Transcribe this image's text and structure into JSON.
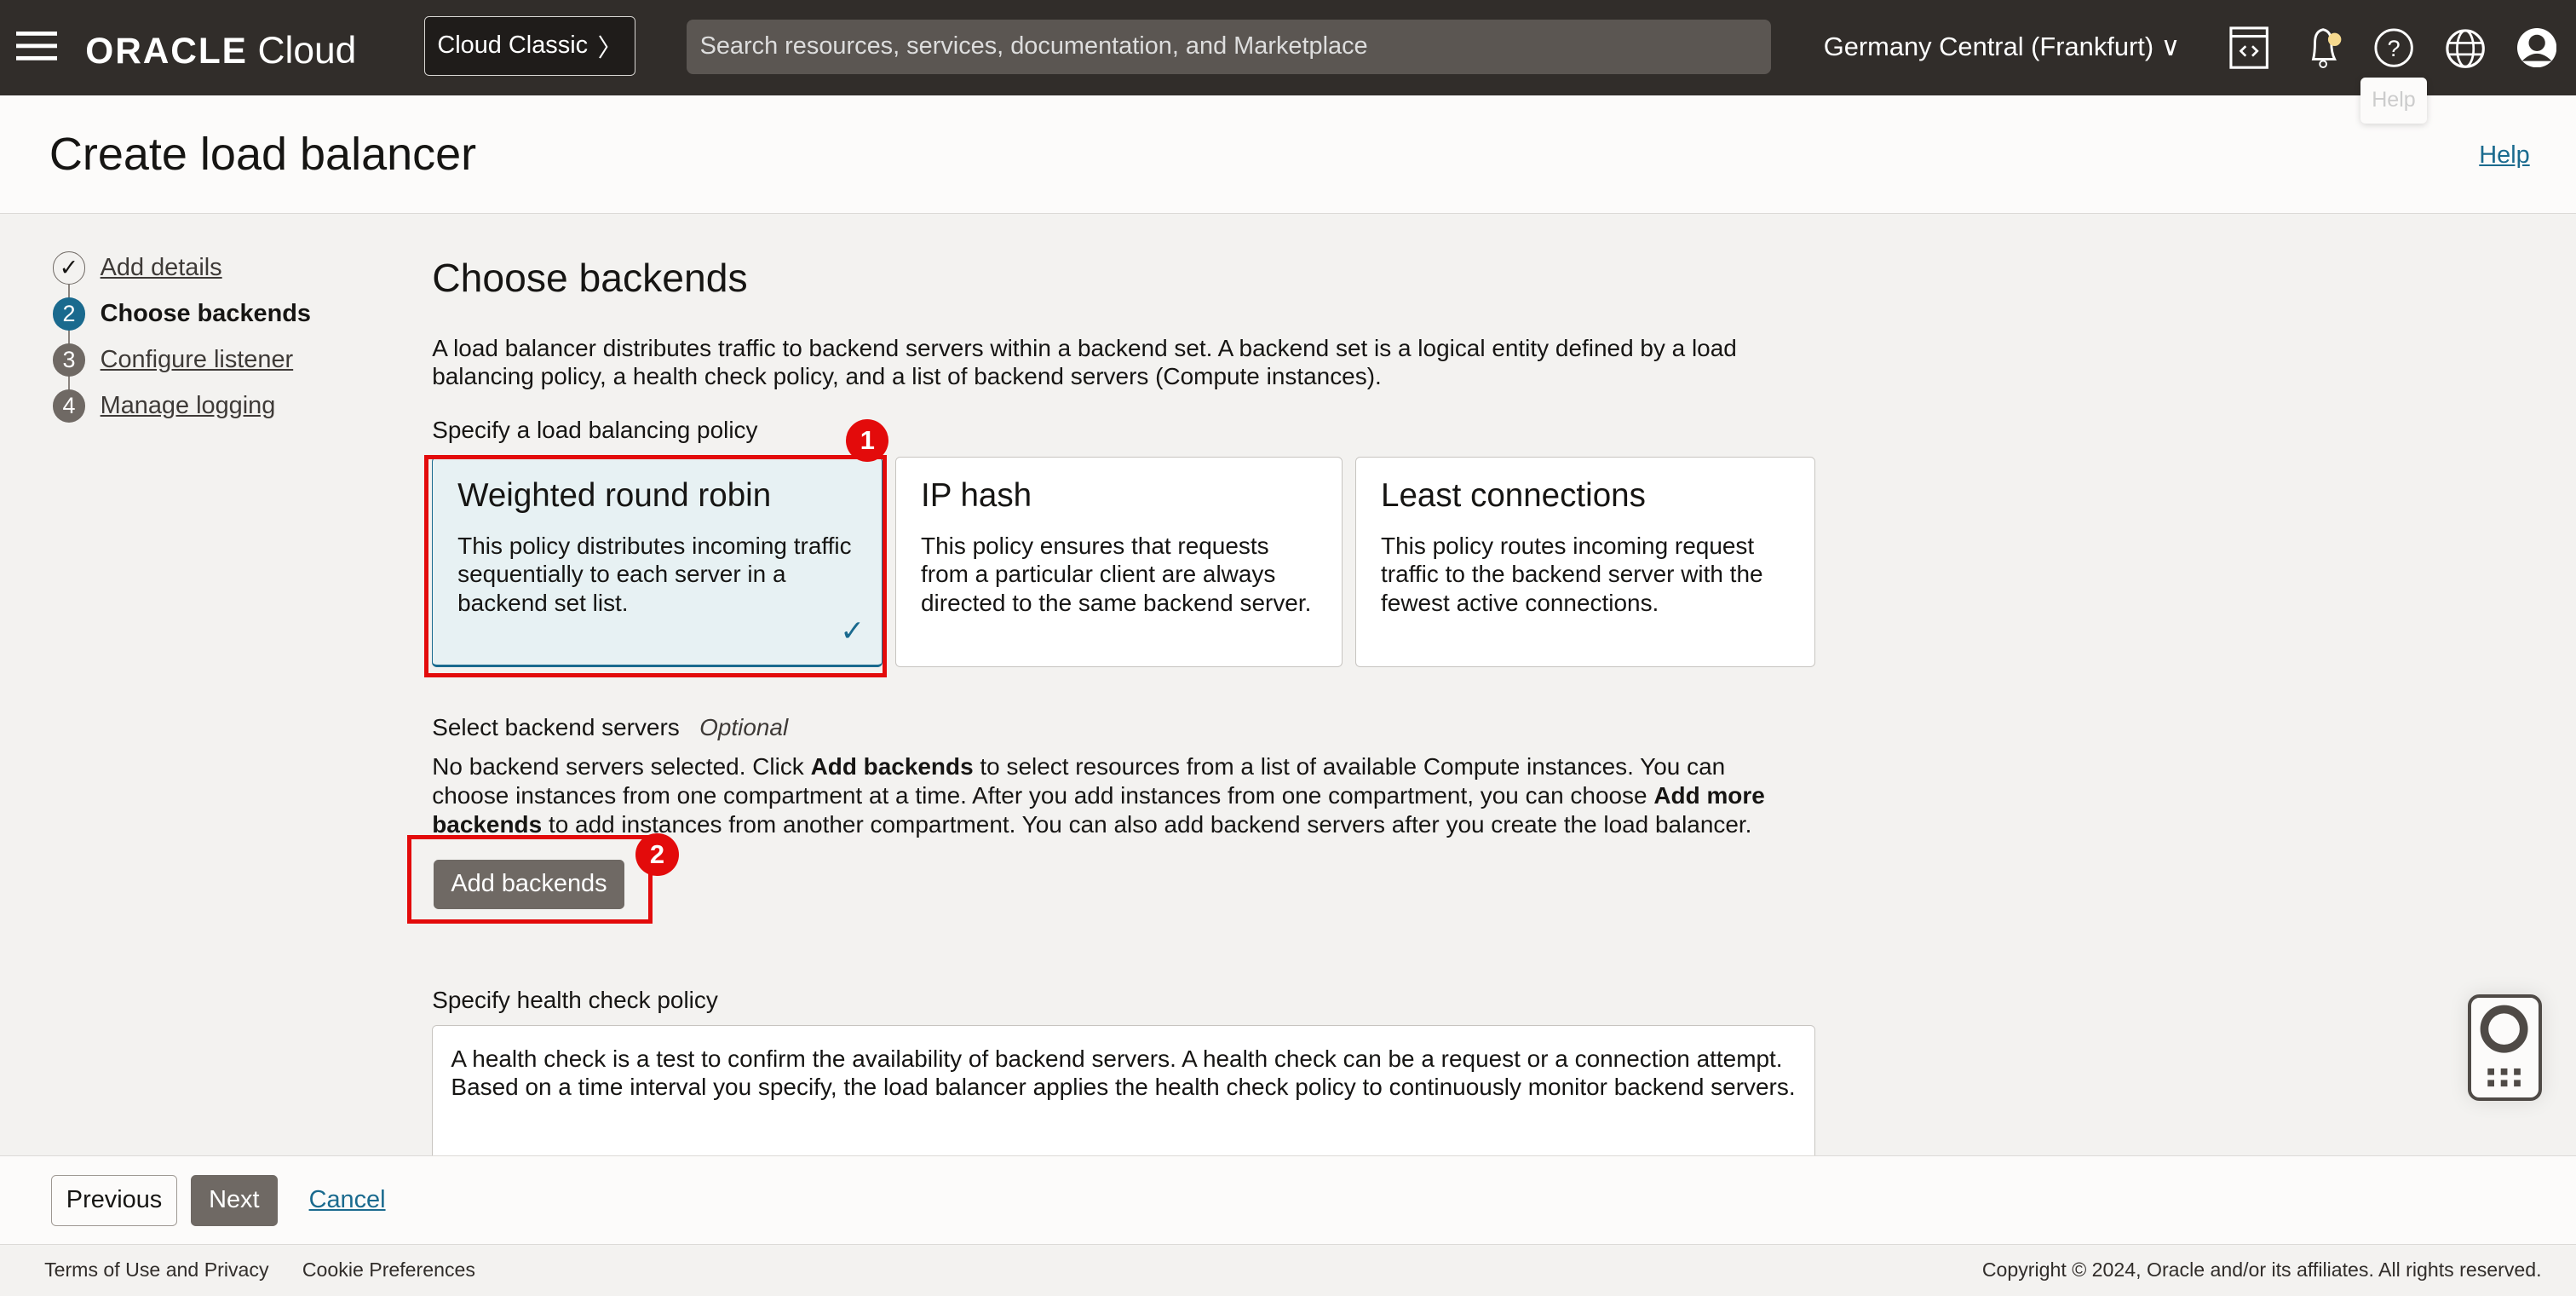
{
  "header": {
    "brand": "ORACLE",
    "brand_suffix": "Cloud",
    "classic_button": "Cloud Classic",
    "search_placeholder": "Search resources, services, documentation, and Marketplace",
    "region": "Germany Central (Frankfurt)",
    "tooltip": "Help",
    "notification_dot_color": "#f6d98e"
  },
  "page": {
    "title": "Create load balancer",
    "help_link": "Help"
  },
  "steps": [
    {
      "num": "1",
      "label": "Add details",
      "state": "complete"
    },
    {
      "num": "2",
      "label": "Choose backends",
      "state": "current"
    },
    {
      "num": "3",
      "label": "Configure listener",
      "state": "pending"
    },
    {
      "num": "4",
      "label": "Manage logging",
      "state": "pending"
    }
  ],
  "main": {
    "heading": "Choose backends",
    "intro": "A load balancer distributes traffic to backend servers within a backend set. A backend set is a logical entity defined by a load balancing policy, a health check policy, and a list of backend servers (Compute instances).",
    "policy_label": "Specify a load balancing policy",
    "policies": [
      {
        "title": "Weighted round robin",
        "desc": "This policy distributes incoming traffic sequentially to each server in a backend set list.",
        "selected": true
      },
      {
        "title": "IP hash",
        "desc": "This policy ensures that requests from a particular client are always directed to the same backend server.",
        "selected": false
      },
      {
        "title": "Least connections",
        "desc": "This policy routes incoming request traffic to the backend server with the fewest active connections.",
        "selected": false
      }
    ],
    "backends_label": "Select backend servers",
    "backends_optional": "Optional",
    "backends_text_1": "No backend servers selected. Click ",
    "backends_bold_1": "Add backends",
    "backends_text_2": " to select resources from a list of available Compute instances. You can choose instances from one compartment at a time. After you add instances from one compartment, you can choose ",
    "backends_bold_2": "Add more backends",
    "backends_text_3": " to add instances from another compartment. You can also add backend servers after you create the load balancer.",
    "add_backends": "Add backends",
    "health_label": "Specify health check policy",
    "health_text": "A health check is a test to confirm the availability of backend servers. A health check can be a request or a connection attempt. Based on a time interval you specify, the load balancer applies the health check policy to continuously monitor backend servers.",
    "annotations": [
      "1",
      "2"
    ]
  },
  "footer": {
    "previous": "Previous",
    "next": "Next",
    "cancel": "Cancel"
  },
  "bottom": {
    "terms": "Terms of Use and Privacy",
    "cookies": "Cookie Preferences",
    "copyright": "Copyright © 2024, Oracle and/or its affiliates. All rights reserved."
  }
}
